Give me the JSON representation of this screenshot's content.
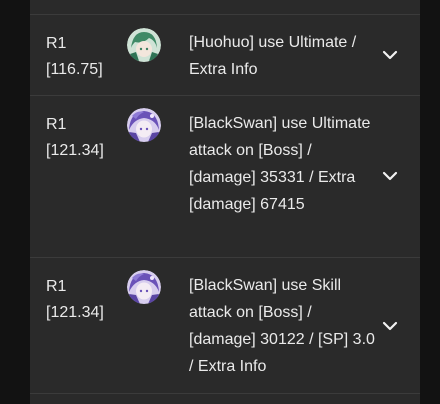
{
  "entries": [
    {
      "round": "R1",
      "action_value": "[116.75]",
      "character": "Huohuo",
      "avatar_icon": "huohuo-avatar-icon",
      "description": "[Huohuo] use Ultimate / Extra Info"
    },
    {
      "round": "R1",
      "action_value": "[121.34]",
      "character": "BlackSwan",
      "avatar_icon": "blackswan-avatar-icon",
      "description": "[BlackSwan] use Ultimate attack on [Boss] / [damage] 35331 / Extra [damage] 67415"
    },
    {
      "round": "R1",
      "action_value": "[121.34]",
      "character": "BlackSwan",
      "avatar_icon": "blackswan-avatar-icon",
      "description": "[BlackSwan] use Skill attack on [Boss] / [damage] 30122 / [SP] 3.0 / Extra Info"
    }
  ],
  "colors": {
    "background": "#121212",
    "panel": "#2a2a2a",
    "divider": "#3b3b3b",
    "text": "#eaeaea"
  },
  "expand_icon": "chevron-down-icon"
}
